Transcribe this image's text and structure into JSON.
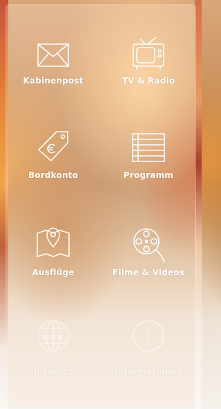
{
  "menu": {
    "items": [
      {
        "label": "Kabinenpost",
        "icon": "envelope-icon"
      },
      {
        "label": "TV & Radio",
        "icon": "tv-icon"
      },
      {
        "label": "Bordkonto",
        "icon": "price-tag-euro-icon"
      },
      {
        "label": "Programm",
        "icon": "list-icon"
      },
      {
        "label": "Ausflüge",
        "icon": "map-pin-icon"
      },
      {
        "label": "Filme & Videos",
        "icon": "film-reel-icon"
      },
      {
        "label": "Internet",
        "icon": "globe-www-icon"
      },
      {
        "label": "Informationen",
        "icon": "info-icon"
      }
    ]
  }
}
